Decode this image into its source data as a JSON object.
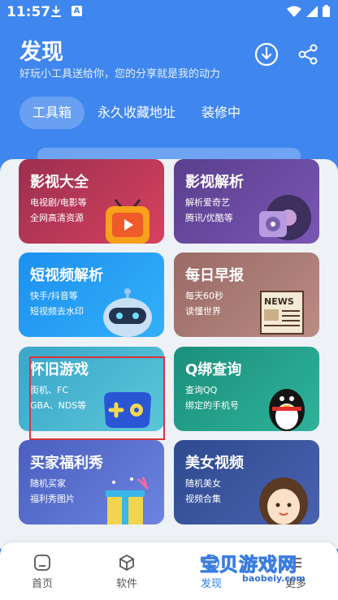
{
  "status_bar": {
    "time": "11:57",
    "badge": "A"
  },
  "header": {
    "title": "发现",
    "subtitle": "好玩小工具送给你，您的分享就是我的动力"
  },
  "tabs": [
    {
      "label": "工具箱",
      "active": true
    },
    {
      "label": "永久收藏地址",
      "active": false
    },
    {
      "label": "装修中",
      "active": false
    }
  ],
  "cards": [
    {
      "title": "影视大全",
      "desc": "电视剧/电影等\n全网高清资源",
      "icon": "tv-play-icon"
    },
    {
      "title": "影视解析",
      "desc": "解析爱奇艺\n腾讯/优酷等",
      "icon": "film-reel-icon"
    },
    {
      "title": "短视频解析",
      "desc": "快手/抖音等\n短视频去水印",
      "icon": "robot-icon"
    },
    {
      "title": "每日早报",
      "desc": "每天60秒\n读懂世界",
      "icon": "newspaper-icon"
    },
    {
      "title": "怀旧游戏",
      "desc": "街机、FC\nGBA、NDS等",
      "icon": "gamepad-icon"
    },
    {
      "title": "Q绑查询",
      "desc": "查询QQ\n绑定的手机号",
      "icon": "penguin-icon"
    },
    {
      "title": "买家福利秀",
      "desc": "随机买家\n福利秀图片",
      "icon": "gift-box-icon"
    },
    {
      "title": "美女视频",
      "desc": "随机美女\n视频合集",
      "icon": "girl-avatar-icon"
    }
  ],
  "bottom_nav": [
    {
      "label": "首页",
      "icon": "home-icon"
    },
    {
      "label": "软件",
      "icon": "cube-icon"
    },
    {
      "label": "发现",
      "icon": "discover-icon",
      "active": true
    },
    {
      "label": "更多",
      "icon": "more-icon"
    }
  ],
  "watermark": {
    "text": "宝贝游戏网",
    "url": "baobeiy.com"
  },
  "colors": {
    "header_bg": "#3f86ee",
    "active_nav": "#2f7ef0",
    "highlight": "#d9333a"
  }
}
